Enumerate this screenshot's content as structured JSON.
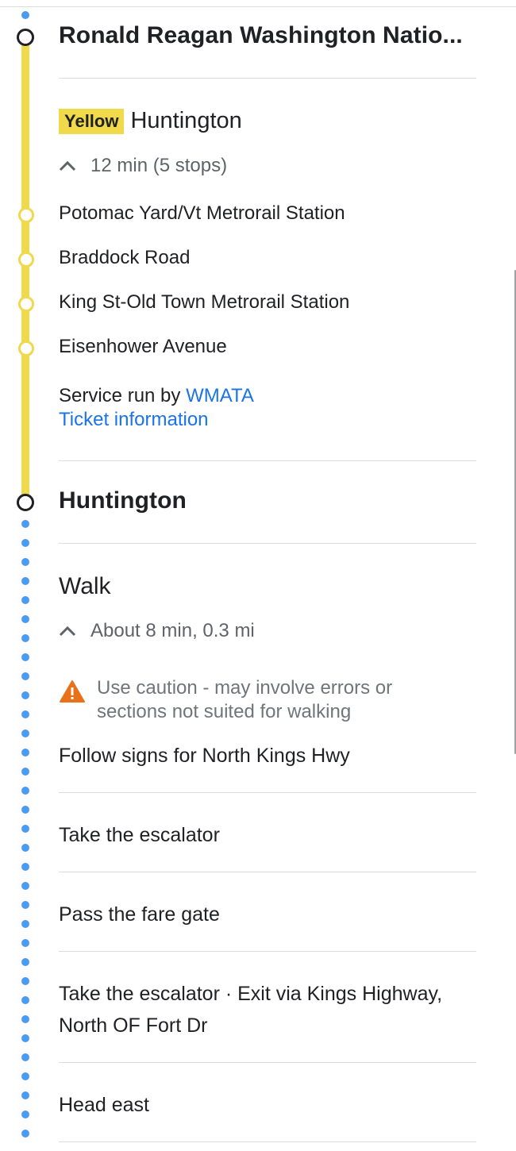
{
  "origin": {
    "name": "Ronald Reagan Washington Natio..."
  },
  "transit": {
    "line_badge": "Yellow",
    "headsign": "Huntington",
    "duration": "12 min",
    "stops_count": "(5 stops)",
    "stops": [
      "Potomac Yard/Vt Metrorail Station",
      "Braddock Road",
      "King St-Old Town Metrorail Station",
      "Eisenhower Avenue"
    ],
    "service_prefix": "Service run by",
    "agency": "WMATA",
    "ticket_link": "Ticket information"
  },
  "arrival": {
    "name": "Huntington"
  },
  "walk": {
    "title": "Walk",
    "duration": "About 8 min, 0.3 mi",
    "warning_line1": "Use caution - may involve errors or",
    "warning_line2": "sections not suited for walking",
    "steps": [
      "Follow signs for North Kings Hwy",
      "Take the escalator",
      "Pass the fare gate",
      "Take the escalator · Exit via Kings Highway, North OF Fort Dr"
    ],
    "last_step_bold": "Head",
    "last_step_rest": "east"
  },
  "colors": {
    "line_yellow": "#f0d94a",
    "walk_dots": "#4b9bf2",
    "link": "#1a73e8",
    "warning": "#e8711a"
  },
  "icons": [
    "chevron-up-icon",
    "warning-icon",
    "station-ring-icon"
  ]
}
